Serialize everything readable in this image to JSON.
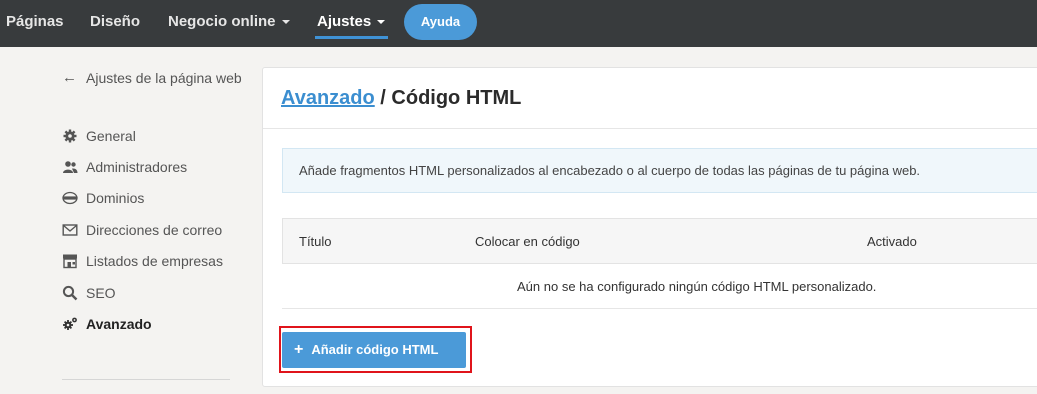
{
  "nav": {
    "items": [
      {
        "label": "Páginas"
      },
      {
        "label": "Diseño"
      },
      {
        "label": "Negocio online"
      },
      {
        "label": "Ajustes"
      }
    ],
    "help_label": "Ayuda"
  },
  "sidebar": {
    "back_label": "Ajustes de la página web",
    "items": [
      {
        "label": "General",
        "icon": "gear-icon"
      },
      {
        "label": "Administradores",
        "icon": "users-icon"
      },
      {
        "label": "Dominios",
        "icon": "www-icon"
      },
      {
        "label": "Direcciones de correo",
        "icon": "envelope-icon"
      },
      {
        "label": "Listados de empresas",
        "icon": "storefront-icon"
      },
      {
        "label": "SEO",
        "icon": "search-icon"
      },
      {
        "label": "Avanzado",
        "icon": "gears-icon",
        "active": true
      }
    ]
  },
  "main": {
    "breadcrumb_link": "Avanzado",
    "breadcrumb_sep": " / ",
    "title": "Código HTML",
    "info": "Añade fragmentos HTML personalizados al encabezado o al cuerpo de todas las páginas de tu página web.",
    "table": {
      "columns": [
        "Título",
        "Colocar en código",
        "Activado"
      ],
      "empty_message": "Aún no se ha configurado ningún código HTML personalizado."
    },
    "add_button_label": "Añadir código HTML"
  },
  "colors": {
    "accent": "#4b9ad8",
    "nav_bg": "#383b3d",
    "highlight": "#e0141b"
  }
}
